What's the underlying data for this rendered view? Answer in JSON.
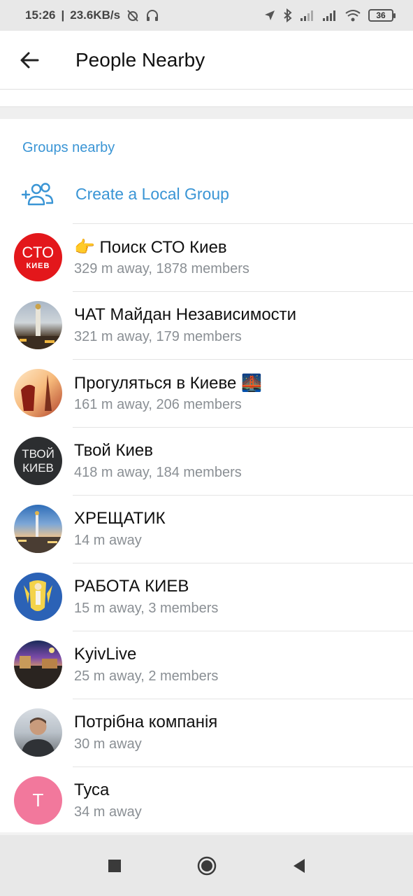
{
  "status_bar": {
    "time": "15:26",
    "speed": "23.6KB/s",
    "battery": "36"
  },
  "header": {
    "title": "People Nearby"
  },
  "section": {
    "title": "Groups nearby",
    "create_label": "Create a Local Group"
  },
  "groups": [
    {
      "title": "👉 Поиск СТО Киев",
      "subtitle": "329 m away, 1878 members",
      "avatar_line1": "СТО",
      "avatar_line2": "КИЕВ"
    },
    {
      "title": "ЧАТ Майдан Независимости",
      "subtitle": "321 m away, 179 members"
    },
    {
      "title": "Прогуляться в Киеве 🌉",
      "subtitle": "161 m away, 206 members"
    },
    {
      "title": "Твой Киев",
      "subtitle": "418 m away, 184 members",
      "avatar_line1": "ТВОЙ",
      "avatar_line2": "КИЕВ"
    },
    {
      "title": "ХРЕЩАТИК",
      "subtitle": "14 m away"
    },
    {
      "title": "РАБОТА КИЕВ",
      "subtitle": "15 m away, 3 members"
    },
    {
      "title": "KyivLive",
      "subtitle": "25 m away, 2 members"
    },
    {
      "title": "Потрібна компанія",
      "subtitle": "30 m away"
    },
    {
      "title": "Туса",
      "subtitle": "34 m away",
      "avatar_letter": "T"
    }
  ],
  "colors": {
    "accent": "#3a95d5",
    "sto_avatar": "#e3171b",
    "tusa_avatar": "#f2789c"
  }
}
